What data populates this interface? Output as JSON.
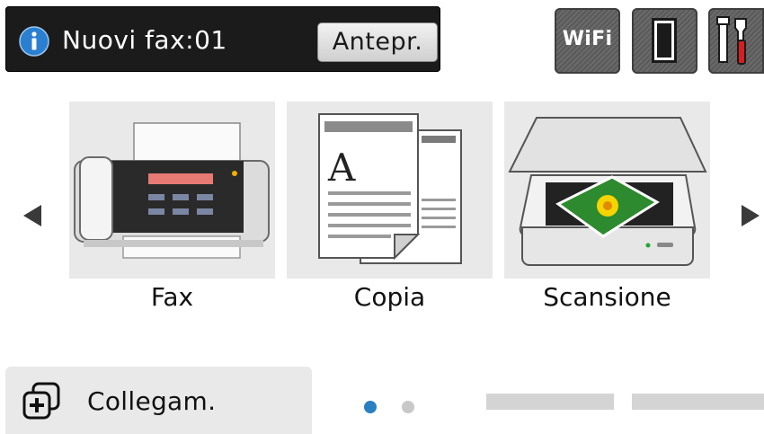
{
  "notification": {
    "text": "Nuovi fax:01",
    "preview_label": "Antepr."
  },
  "status_icons": {
    "wifi_label": "WiFi"
  },
  "tiles": [
    {
      "label": "Fax",
      "icon": "fax-machine-icon"
    },
    {
      "label": "Copia",
      "icon": "copy-documents-icon"
    },
    {
      "label": "Scansione",
      "icon": "scanner-icon"
    }
  ],
  "shortcut": {
    "label": "Collegam.",
    "icon": "add-shortcut-icon"
  },
  "pagination": {
    "current_page": 1,
    "total_pages": 2
  },
  "colors": {
    "notification_bg": "#1b1b1b",
    "info_blue": "#2b7fd0",
    "active_dot": "#2a7fc1",
    "tile_bg": "#e9e9e9",
    "tools_red": "#d42020"
  }
}
